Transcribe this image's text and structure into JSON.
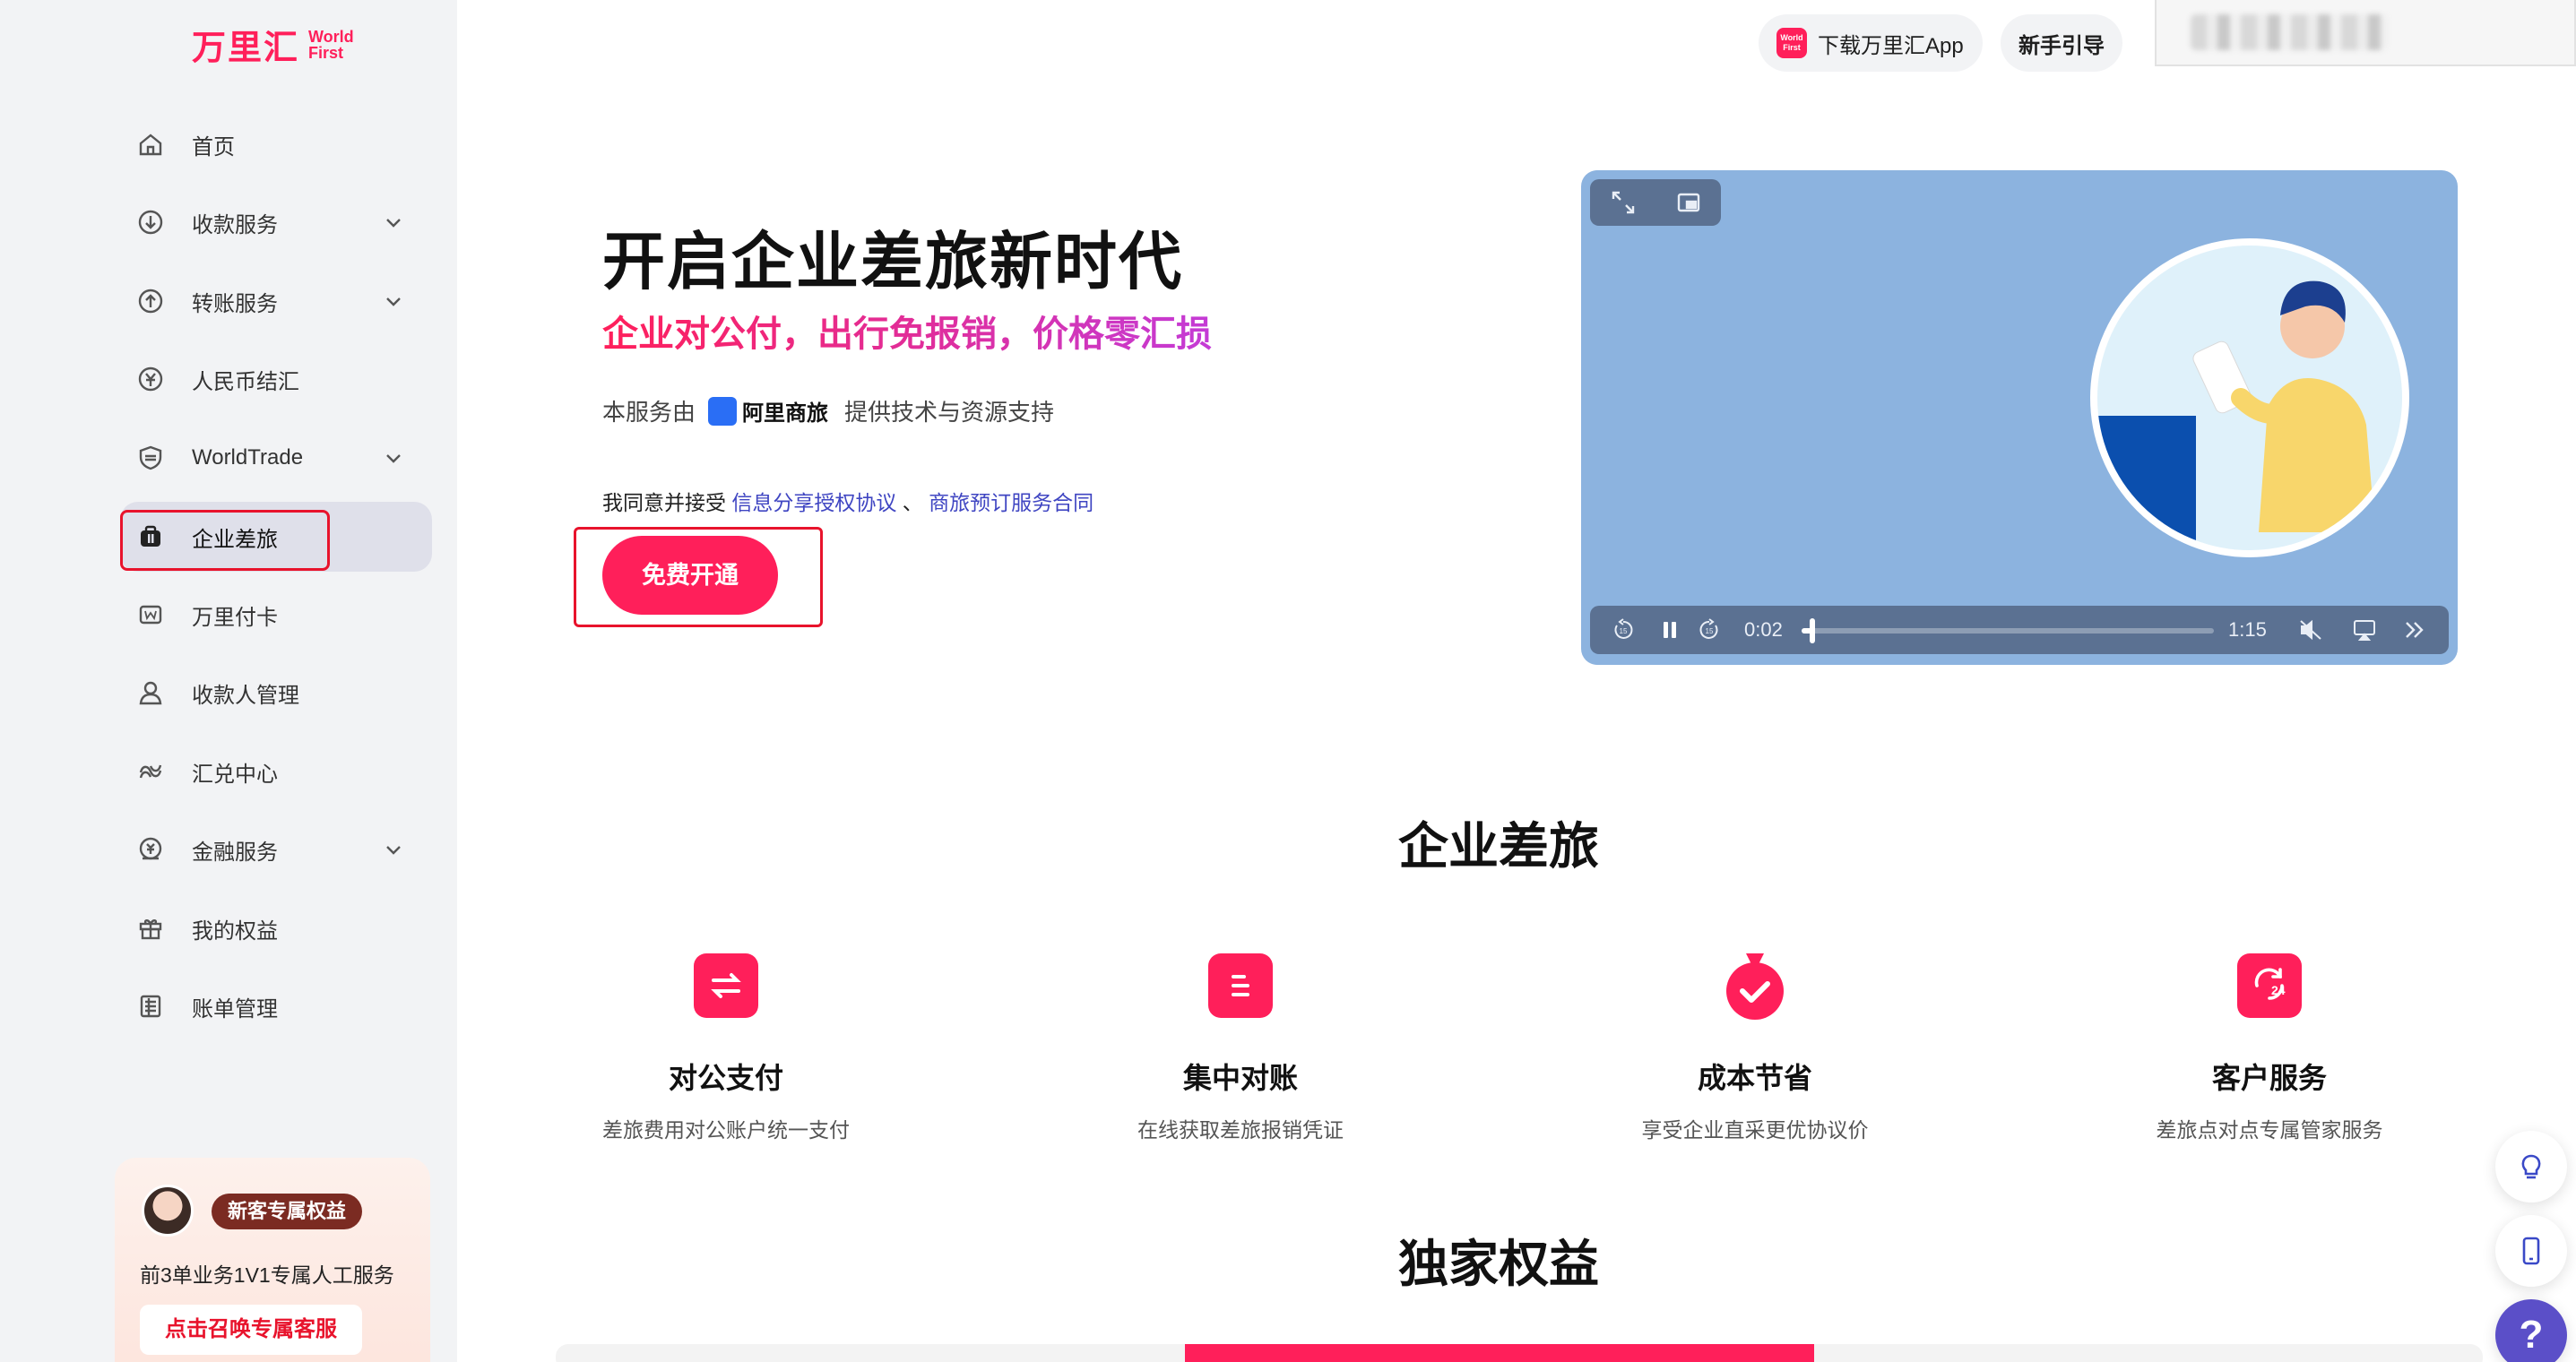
{
  "brand": {
    "name_cn": "万里汇",
    "name_en": "World First"
  },
  "sidebar": {
    "items": [
      {
        "label": "首页",
        "icon": "home-icon",
        "has_chevron": false
      },
      {
        "label": "收款服务",
        "icon": "receive-icon",
        "has_chevron": true
      },
      {
        "label": "转账服务",
        "icon": "transfer-icon",
        "has_chevron": true
      },
      {
        "label": "人民币结汇",
        "icon": "rmb-icon",
        "has_chevron": false
      },
      {
        "label": "WorldTrade",
        "icon": "shield-icon",
        "has_chevron": true
      },
      {
        "label": "企业差旅",
        "icon": "briefcase-icon",
        "has_chevron": false,
        "active": true
      },
      {
        "label": "万里付卡",
        "icon": "card-icon",
        "has_chevron": false
      },
      {
        "label": "收款人管理",
        "icon": "user-icon",
        "has_chevron": false
      },
      {
        "label": "汇兑中心",
        "icon": "exchange-icon",
        "has_chevron": false
      },
      {
        "label": "金融服务",
        "icon": "finance-icon",
        "has_chevron": true
      },
      {
        "label": "我的权益",
        "icon": "gift-icon",
        "has_chevron": false
      },
      {
        "label": "账单管理",
        "icon": "bill-icon",
        "has_chevron": false
      }
    ],
    "promo": {
      "badge": "新客专属权益",
      "desc": "前3单业务1V1专属人工服务",
      "cta": "点击召唤专属客服"
    }
  },
  "topbar": {
    "app_logo_text": "World First",
    "download_label": "下载万里汇App",
    "guide_label": "新手引导"
  },
  "hero": {
    "title": "开启企业差旅新时代",
    "subtitle": "企业对公付，出行免报销，价格零汇损",
    "service_prefix": "本服务由",
    "partner": "阿里商旅",
    "service_suffix": "提供技术与资源支持",
    "agree_prefix": "我同意并接受",
    "agreement_1": "信息分享授权协议",
    "agree_sep": "、",
    "agreement_2": "商旅预订服务合同",
    "cta": "免费开通"
  },
  "video": {
    "current_time": "0:02",
    "duration": "1:15",
    "progress": 0.027
  },
  "features": {
    "title": "企业差旅",
    "items": [
      {
        "title": "对公支付",
        "desc": "差旅费用对公账户统一支付",
        "icon": "transfer-arrows-icon"
      },
      {
        "title": "集中对账",
        "desc": "在线获取差旅报销凭证",
        "icon": "list-icon"
      },
      {
        "title": "成本节省",
        "desc": "享受企业直采更优协议价",
        "icon": "moneybag-check-icon"
      },
      {
        "title": "客户服务",
        "desc": "差旅点对点专属管家服务",
        "icon": "service-24-icon"
      }
    ]
  },
  "benefits": {
    "title": "独家权益"
  },
  "colors": {
    "accent": "#ff1f5a",
    "link": "#3f45c2",
    "sidebar_bg": "#f2f3f5",
    "video_bg": "#8cb3df"
  }
}
